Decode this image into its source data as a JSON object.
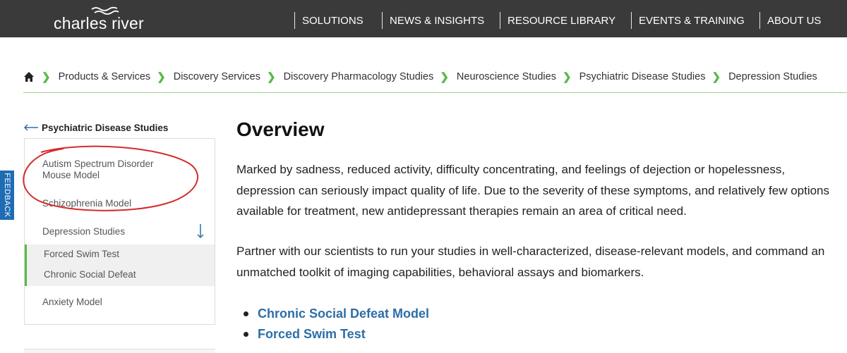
{
  "header": {
    "logo_text": "charles river",
    "nav": [
      {
        "label": "SOLUTIONS"
      },
      {
        "label": "NEWS & INSIGHTS"
      },
      {
        "label": "RESOURCE LIBRARY"
      },
      {
        "label": "EVENTS & TRAINING"
      },
      {
        "label": "ABOUT US"
      }
    ]
  },
  "breadcrumb": {
    "home_icon": "home-icon",
    "items": [
      "Products & Services",
      "Discovery Services",
      "Discovery Pharmacology Studies",
      "Neuroscience Studies",
      "Psychiatric Disease Studies",
      "Depression Studies"
    ]
  },
  "sidebar": {
    "back_label": "Psychiatric Disease Studies",
    "items": [
      "Autism Spectrum Disorder",
      "Mouse Model",
      "Schizophrenia Model",
      "Depression Studies",
      "Anxiety Model"
    ],
    "sub_items": [
      "Forced Swim Test",
      "Chronic Social Defeat"
    ],
    "expanded_icon": "arrow-down-icon"
  },
  "feedback": {
    "label": "FEEDBACK"
  },
  "main": {
    "title": "Overview",
    "paragraph1": "Marked by sadness, reduced activity, difficulty concentrating, and feelings of dejection or hopelessness, depression can seriously impact quality of life. Due to the severity of these symptoms, and relatively few options available for treatment, new antidepressant therapies remain an area of critical need.",
    "paragraph2": "Partner with our scientists to run your studies in well-characterized, disease-relevant models, and command an unmatched toolkit of imaging capabilities, behavioral assays and biomarkers.",
    "links": [
      "Chronic Social Defeat Model",
      "Forced Swim Test"
    ]
  },
  "colors": {
    "topbar": "#3a3a3a",
    "accent_green": "#58b947",
    "link_blue": "#2d6ea8",
    "feedback_blue": "#1f6cb4",
    "annotation_red": "#d62b2b"
  }
}
